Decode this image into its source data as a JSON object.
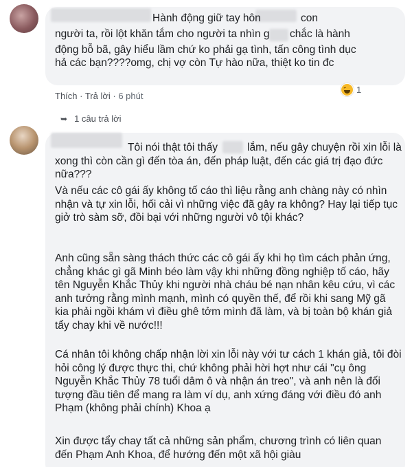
{
  "comment1": {
    "text_start": "Hành động giữ tay hôn",
    "text_mid1": "con",
    "text_line2": "người ta, rồi lột khăn tắm cho người ta nhìn g",
    "text_line2b": "chắc là hành",
    "text_rest": "động bỗ bã, gây hiểu lầm chứ ko phải gạ tình, tấn công tình dục hả các bạn????omg, chị vợ còn Tự hào nữa, thiệt ko tin đc",
    "meta_like": "Thích",
    "meta_sep1": " · ",
    "meta_reply": "Trả lời",
    "meta_sep2": " · ",
    "meta_time": "6 phút",
    "reaction_count": "1",
    "reaction_icon": "haha-icon"
  },
  "replies": {
    "label": "1 câu trả lời",
    "icon": "reply-arrow-icon"
  },
  "comment2": {
    "p1a": "Tôi nói thật tôi thấy",
    "p1b": "lắm, nếu gây chuyện rồi xin lỗi là xong thì còn cần gì đến tòa án, đến pháp luật, đến các giá trị đạo đức nữa???",
    "p2": "Và nếu các cô gái ấy không tố cáo thì liệu rằng anh chàng này có nhìn nhận và tự xin lỗi, hối cải vì những việc đã gây ra không? Hay lại tiếp tục giở trò sàm sỡ, đồi bại với những người vô tội khác?",
    "p3": "Anh cũng sẵn sàng thách thức các cô gái ấy khi họ tìm cách phản ứng, chẳng khác gì gã Minh béo làm vậy khi những đồng nghiệp tố cáo, hãy tên Nguyễn Khắc Thủy khi người nhà cháu bé nạn nhân kêu cứu, vì các anh tưởng rằng mình mạnh, mình có quyền thế, để rồi khi sang Mỹ gã kia phải ngồi khám vì điều ghê tởm mình đã làm, và bị toàn bộ khán giả tẩy chay khi về nước!!!",
    "p4": "Cá nhân tôi không chấp nhận lời xin lỗi này với tư cách 1 khán giả, tôi đòi hỏi công lý được thực thi, chứ không phải hời hợt như cái \"cụ ông Nguyễn Khắc Thủy 78 tuổi dâm ô và nhận án treo\", và anh nên là đối tượng đầu tiên để mang ra làm ví dụ, anh xứng đáng với điều đó anh Phạm (không phải chính) Khoa ạ",
    "p5": "Xin được tẩy chay tất cả những sản phẩm, chương trình có liên quan đến Phạm Anh Khoa, để hướng đến một xã hội giàu"
  }
}
